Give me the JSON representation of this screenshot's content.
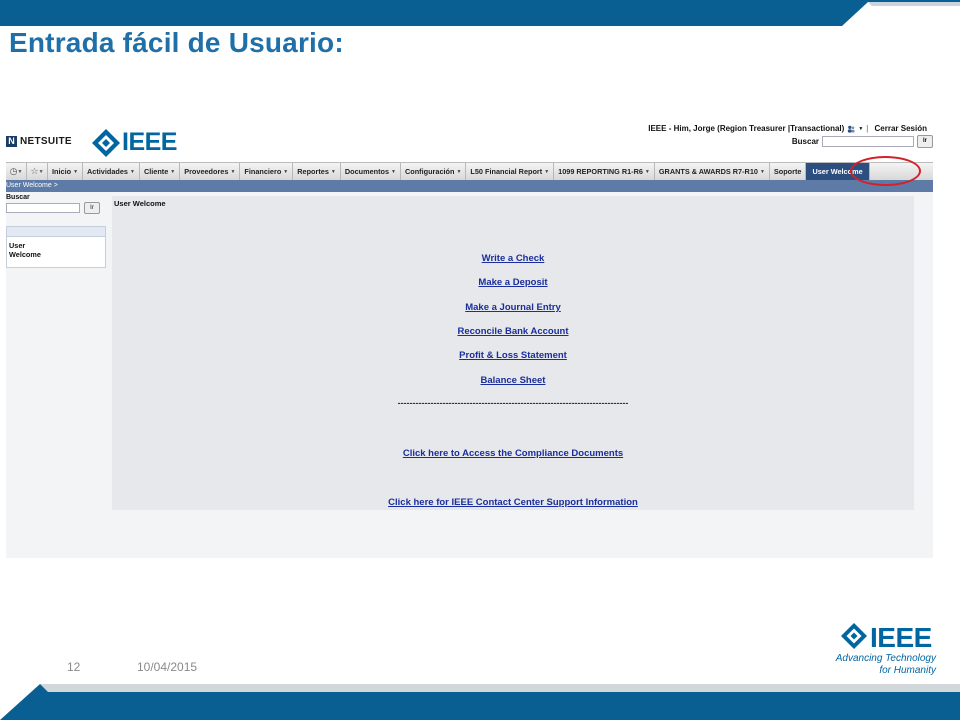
{
  "slide": {
    "title": "Entrada fácil de Usuario:",
    "page_number": "12",
    "date": "10/04/2015",
    "brand_color": "#0066a1",
    "band_color": "#0a5f92",
    "logo": {
      "word": "IEEE",
      "tagline_1": "Advancing Technology",
      "tagline_2": "for Humanity"
    }
  },
  "netsuite": {
    "logo_mark": "N",
    "logo_text": "NETSUITE",
    "header_logo_word": "IEEE",
    "user_label": "IEEE - Him, Jorge (Region Treasurer |Transactional)",
    "logout": "Cerrar Sesión",
    "search_label": "Buscar",
    "search_value": "",
    "go_label": "Ir",
    "nav_icons": [
      "clock-icon",
      "star-icon"
    ],
    "nav_tabs": [
      {
        "label": "Inicio",
        "has_menu": true
      },
      {
        "label": "Actividades",
        "has_menu": true
      },
      {
        "label": "Cliente",
        "has_menu": true
      },
      {
        "label": "Proveedores",
        "has_menu": true
      },
      {
        "label": "Financiero",
        "has_menu": true
      },
      {
        "label": "Reportes",
        "has_menu": true
      },
      {
        "label": "Documentos",
        "has_menu": true
      },
      {
        "label": "Configuración",
        "has_menu": true
      },
      {
        "label": "L50 Financial Report",
        "has_menu": true
      },
      {
        "label": "1099 REPORTING R1-R6",
        "has_menu": true
      },
      {
        "label": "GRANTS & AWARDS R7-R10",
        "has_menu": true
      },
      {
        "label": "Soporte",
        "has_menu": false
      },
      {
        "label": "User Welcome",
        "has_menu": false,
        "active": true
      }
    ],
    "breadcrumb": "User Welcome >",
    "left_panel": {
      "search_label": "Buscar",
      "search_value": "",
      "go_label": "Ir",
      "portlet_items": [
        "User",
        "Welcome"
      ]
    },
    "content": {
      "title": "User Welcome",
      "links": [
        "Write a Check",
        "Make a Deposit",
        "Make a Journal Entry",
        "Reconcile Bank Account",
        "Profit & Loss Statement",
        "Balance Sheet"
      ],
      "divider": "-----------------------------------------------------------------------------",
      "compliance_link": "Click here to Access the Compliance Documents",
      "support_link": "Click here for IEEE Contact Center Support Information"
    },
    "highlight_color": "#d42127",
    "nav_active_color": "#2d4f80",
    "crumb_color": "#5e7aa6",
    "link_color": "#1a2e9c"
  }
}
